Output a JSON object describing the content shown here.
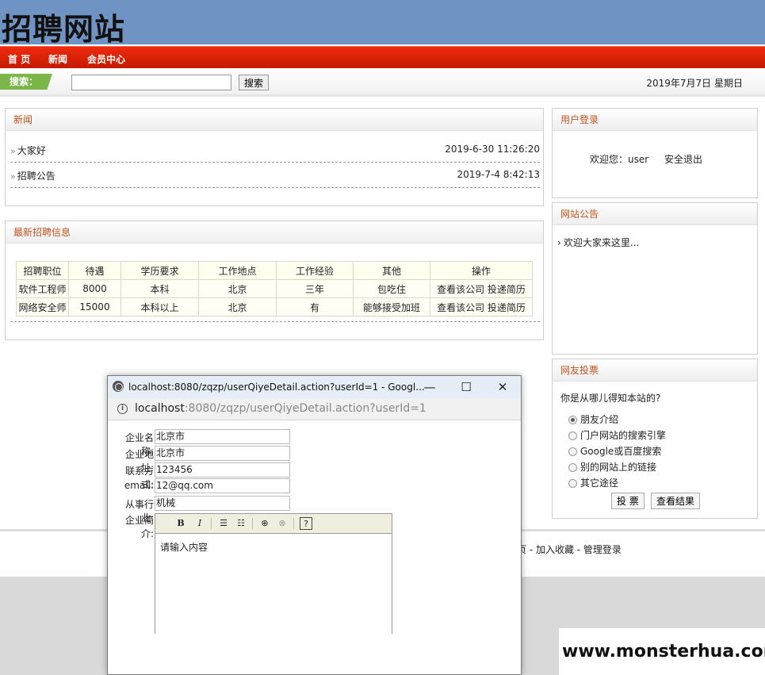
{
  "site": {
    "logo": "招聘网站"
  },
  "nav": {
    "items": [
      "首 页",
      "新闻",
      "会员中心"
    ]
  },
  "search": {
    "label": "搜索：",
    "placeholder": "",
    "button": "搜索",
    "date": "2019年7月7日 星期日"
  },
  "news": {
    "title": "新闻",
    "items": [
      {
        "title": "大家好",
        "time": "2019-6-30 11:26:20"
      },
      {
        "title": "招聘公告",
        "time": "2019-7-4 8:42:13"
      }
    ]
  },
  "jobs": {
    "title": "最新招聘信息",
    "headers": [
      "招聘职位",
      "待遇",
      "学历要求",
      "工作地点",
      "工作经验",
      "其他",
      "操作"
    ],
    "rows": [
      [
        "软件工程师",
        "8000",
        "本科",
        "北京",
        "三年",
        "包吃住",
        "查看该公司 投递简历"
      ],
      [
        "网络安全师",
        "15000",
        "本科以上",
        "北京",
        "有",
        "能够接受加班",
        "查看该公司 投递简历"
      ]
    ]
  },
  "login": {
    "title": "用户登录",
    "welcome": "欢迎您：user",
    "logout": "安全退出"
  },
  "notice": {
    "title": "网站公告",
    "item": "欢迎大家来这里..."
  },
  "poll": {
    "title": "网友投票",
    "question": "你是从哪儿得知本站的?",
    "options": [
      "朋友介绍",
      "门户网站的搜索引擎",
      "Google或百度搜索",
      "别的网站上的链接",
      "其它途径"
    ],
    "selected_index": 0,
    "vote_button": "投 票",
    "result_button": "查看结果"
  },
  "footer": {
    "links": "页 - 加入收藏 - 管理登录"
  },
  "popup": {
    "title": "localhost:8080/zqzp/userQiyeDetail.action?userId=1 - Googl...",
    "minimize": "—",
    "maximize": "☐",
    "close": "✕",
    "address_host": "localhost",
    "address_path": ":8080/zqzp/userQiyeDetail.action?userId=1",
    "fields": [
      {
        "label": "企业名称:",
        "value": "北京市"
      },
      {
        "label": "企业地址:",
        "value": "北京市"
      },
      {
        "label": "联系方式:",
        "value": "123456"
      },
      {
        "label": "email:",
        "value": "12@qq.com"
      },
      {
        "label": "从事行业:",
        "value": "机械"
      }
    ],
    "intro_label": "企业简介:",
    "editor_placeholder": "请输入内容"
  },
  "watermark": "www.monsterhua.com"
}
